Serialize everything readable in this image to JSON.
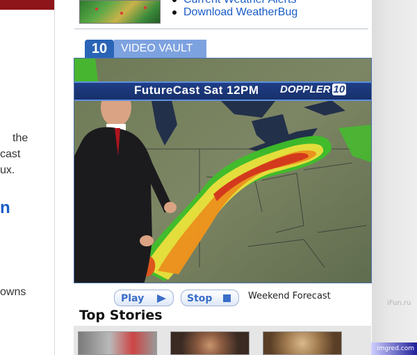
{
  "left_column": {
    "text_lines": [
      "the",
      "cast",
      "ux."
    ],
    "link_fragment": "n",
    "bottom_text": "owns"
  },
  "links": [
    "Current Weather Alerts",
    "Download WeatherBug"
  ],
  "video": {
    "logo": "10",
    "tab_label": "VIDEO VAULT",
    "banner_text": "FutureCast   Sat 12PM",
    "brand": "DOPPLER",
    "brand_number": "10",
    "caption": "Weekend Forecast"
  },
  "controls": {
    "play_label": "Play",
    "stop_label": "Stop"
  },
  "section_title": "Top Stories",
  "watermarks": {
    "ifun": "iFun.ru",
    "imgred": "imgred.com"
  },
  "colors": {
    "brand_red": "#8e1519",
    "link_blue": "#1a5cc8",
    "tab_blue": "#7da2e0"
  }
}
